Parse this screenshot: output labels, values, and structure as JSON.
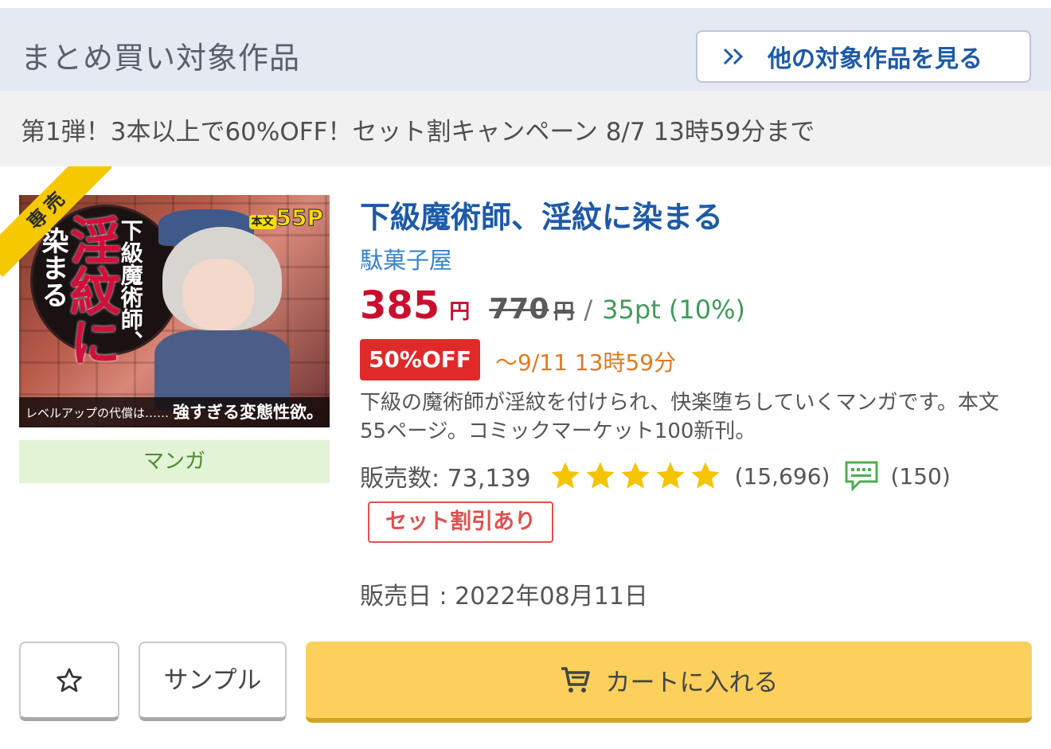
{
  "header": {
    "title": "まとめ買い対象作品",
    "see_more_label": "他の対象作品を見る"
  },
  "campaign": {
    "text": "第1弾！3本以上で60%OFF！セット割キャンペーン  8/7 13時59分まで"
  },
  "thumbnail": {
    "ribbon": "専売",
    "vertical_title": "下級魔術師、",
    "big_title": "淫紋に",
    "small_title": "染まる",
    "pages_small": "本文",
    "pages": "55P",
    "tagline_left": "レベルアップの代償は……",
    "tagline_right": "強すぎる変態性欲。"
  },
  "genre": "マンガ",
  "product": {
    "title": "下級魔術師、淫紋に染まる",
    "circle": "駄菓子屋",
    "price": "385",
    "price_unit": "円",
    "original_price": "770",
    "original_unit": "円",
    "slash": "/",
    "points": "35pt (10%)",
    "discount_badge": "50%OFF",
    "deadline": "〜9/11 13時59分",
    "description": "下級の魔術師が淫紋を付けられ、快楽堕ちしていくマンガです。本文55ページ。コミックマーケット100新刊。",
    "sales": "販売数: 73,139",
    "rating": 5,
    "rating_count": "(15,696)",
    "review_count": "(150)",
    "set_badge": "セット割引あり",
    "release": "販売日 : 2022年08月11日"
  },
  "buttons": {
    "sample": "サンプル",
    "cart": "カートに入れる"
  },
  "colors": {
    "accent_blue": "#1d5aa8",
    "price_red": "#c8102e",
    "points_green": "#3f9b5c",
    "discount_red": "#e02a2a",
    "deadline_orange": "#e07a20",
    "star_yellow": "#f5c400",
    "cart_yellow": "#fcd05c"
  }
}
